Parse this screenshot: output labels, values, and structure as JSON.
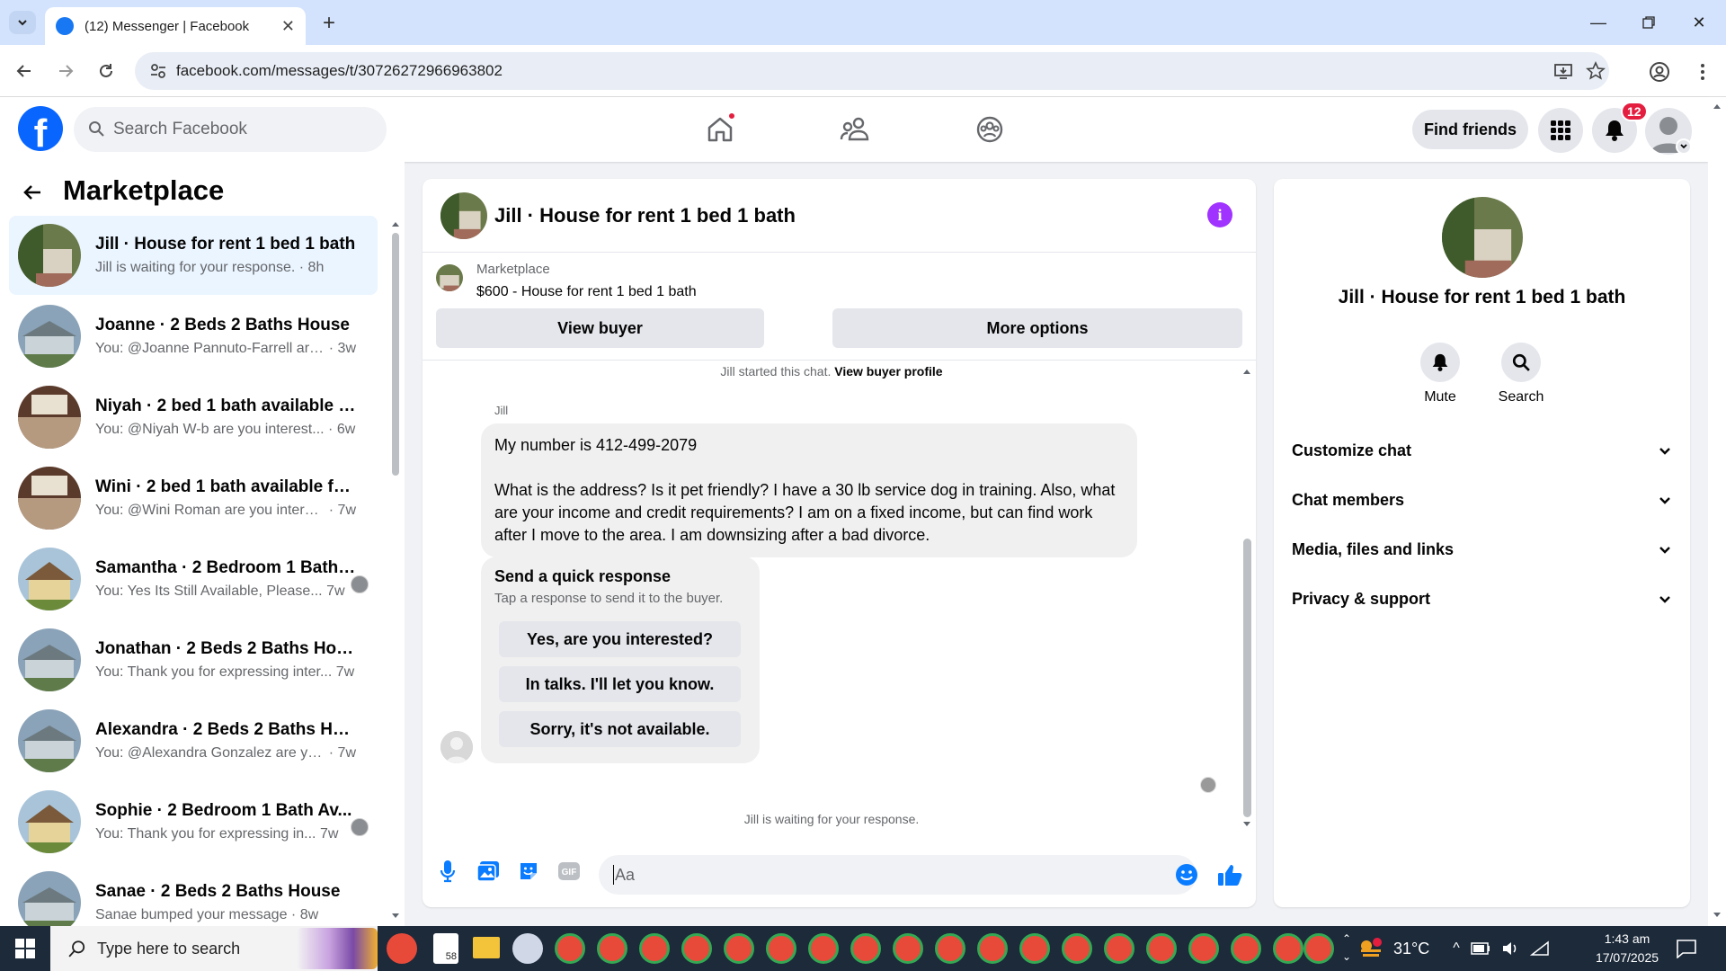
{
  "browser": {
    "tab_title": "(12) Messenger | Facebook",
    "url": "facebook.com/messages/t/30726272966963802"
  },
  "fb_header": {
    "search_placeholder": "Search Facebook",
    "find_friends": "Find friends",
    "notification_count": "12"
  },
  "sidebar": {
    "title": "Marketplace",
    "conversations": [
      {
        "name": "Jill · House for rent 1 bed 1 bath",
        "preview": "Jill is waiting for your response.",
        "time": "· 8h",
        "active": true
      },
      {
        "name": "Joanne · 2 Beds 2 Baths House",
        "preview": "You: @Joanne Pannuto-Farrell are ...",
        "time": "· 3w"
      },
      {
        "name": "Niyah · 2 bed 1 bath available fo...",
        "preview": "You: @Niyah W-b are you interest...",
        "time": "· 6w"
      },
      {
        "name": "Wini · 2 bed 1 bath available for ...",
        "preview": "You: @Wini Roman are you interes...",
        "time": "· 7w"
      },
      {
        "name": "Samantha · 2 Bedroom 1 Bath ...",
        "preview": "You: Yes Its Still Available, Please...",
        "time": "7w"
      },
      {
        "name": "Jonathan · 2 Beds 2 Baths House",
        "preview": "You: Thank you for expressing inter...",
        "time": "7w"
      },
      {
        "name": "Alexandra · 2 Beds 2 Baths House",
        "preview": "You: @Alexandra Gonzalez are you...",
        "time": "· 7w"
      },
      {
        "name": "Sophie · 2 Bedroom 1 Bath Av...",
        "preview": "You: Thank you for expressing in...",
        "time": "7w"
      },
      {
        "name": "Sanae · 2 Beds 2 Baths House",
        "preview": "Sanae bumped your message",
        "time": "· 8w"
      }
    ]
  },
  "chat": {
    "title": "Jill · House for rent 1 bed 1 bath",
    "listing_source": "Marketplace",
    "listing": "$600 - House for rent 1 bed 1 bath",
    "view_buyer": "View buyer",
    "more_options": "More options",
    "started_text": "Jill started this chat.",
    "view_buyer_profile": "View buyer profile",
    "sender": "Jill",
    "message": "My number is 412-499-2079\n\nWhat is the address? Is it pet friendly? I have a 30 lb service dog in training. Also, what are your income and credit requirements?  I am on a fixed income, but can find work after I move to the area. I am downsizing after a bad divorce.",
    "quick_title": "Send a quick response",
    "quick_sub": "Tap a response to send it to the buyer.",
    "quick_responses": [
      "Yes, are you interested?",
      "In talks. I'll let you know.",
      "Sorry, it's not available."
    ],
    "waiting": "Jill is waiting for your response.",
    "input_placeholder": "Aa"
  },
  "info_panel": {
    "name": "Jill · House for rent 1 bed 1 bath",
    "mute": "Mute",
    "search": "Search",
    "sections": [
      "Customize chat",
      "Chat members",
      "Media, files and links",
      "Privacy & support"
    ]
  },
  "taskbar": {
    "search_placeholder": "Type here to search",
    "badge": "58",
    "temperature": "31°C",
    "time": "1:43 am",
    "date": "17/07/2025"
  },
  "colors": {
    "facebook_blue": "#0866ff",
    "messenger_blue": "#0a7cff",
    "info_purple": "#a033ff",
    "badge_red": "#e41e3f"
  }
}
